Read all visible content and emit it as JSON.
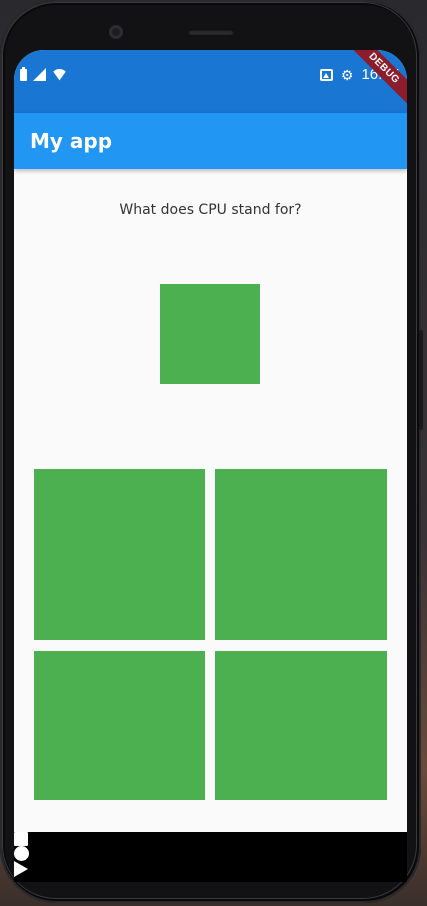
{
  "status_bar": {
    "time": "16:47",
    "icons": [
      "battery-icon",
      "signal-icon",
      "wifi-icon",
      "gallery-icon",
      "settings-icon"
    ]
  },
  "app_bar": {
    "title": "My app"
  },
  "debug_banner": "DEBUG",
  "quiz": {
    "question": "What does CPU stand for?",
    "answers_count": 4
  },
  "navigation": {
    "buttons": [
      "square-nav-icon",
      "home-circle-icon",
      "play-triangle-icon"
    ]
  },
  "colors": {
    "status_bar": "#1976d2",
    "app_bar": "#2196f3",
    "tile": "#4caf50",
    "debug_banner": "#8d1c2c",
    "screen_bg": "#fafafa"
  }
}
